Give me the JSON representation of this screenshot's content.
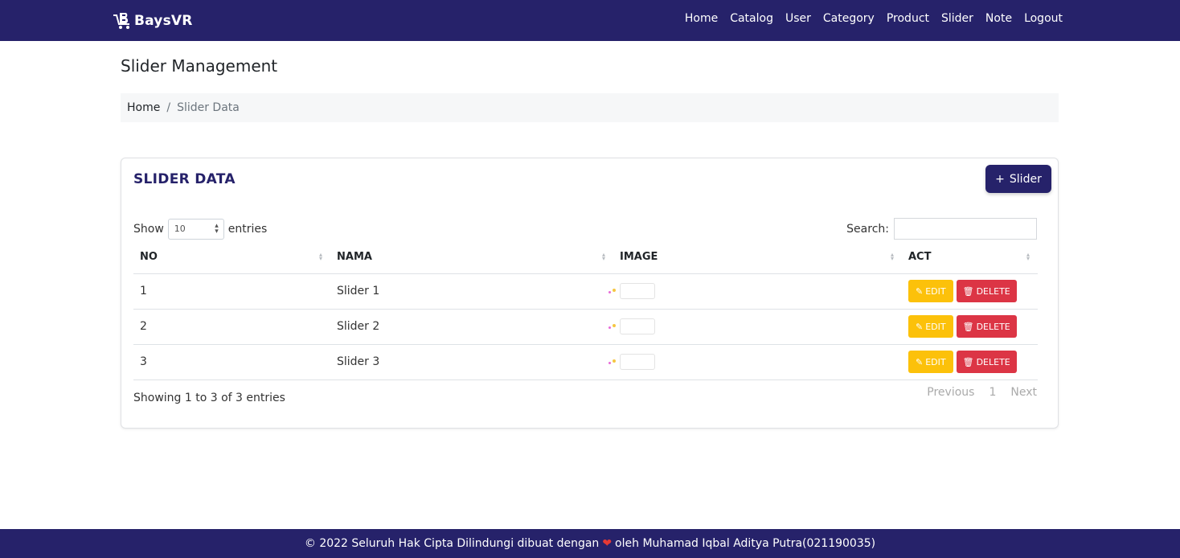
{
  "navbar": {
    "brand": "BaysVR",
    "links": [
      "Home",
      "Catalog",
      "User",
      "Category",
      "Product",
      "Slider",
      "Note",
      "Logout"
    ]
  },
  "page": {
    "title": "Slider Management",
    "breadcrumb": {
      "home": "Home",
      "separator": "/",
      "current": "Slider Data"
    }
  },
  "card": {
    "title": "SLIDER DATA",
    "add_button": "Slider",
    "show_label": "Show",
    "entries_value": "10",
    "entries_label": "entries",
    "search_label": "Search:",
    "search_value": "",
    "columns": [
      "NO",
      "NAMA",
      "IMAGE",
      "ACT"
    ],
    "rows": [
      {
        "no": "1",
        "nama": "Slider 1"
      },
      {
        "no": "2",
        "nama": "Slider 2"
      },
      {
        "no": "3",
        "nama": "Slider 3"
      }
    ],
    "edit_label": "EDIT",
    "delete_label": "DELETE",
    "info": "Showing 1 to 3 of 3 entries",
    "pager": {
      "previous": "Previous",
      "page": "1",
      "next": "Next"
    }
  },
  "footer": {
    "prefix": "© 2022 Seluruh Hak Cipta Dilindungi dibuat dengan",
    "suffix": "oleh Muhamad Iqbal Aditya Putra(021190035)"
  },
  "colors": {
    "primary": "#26226a",
    "edit": "#fcc10a",
    "delete": "#dc3545",
    "heart": "#e53935"
  },
  "icons": [
    "cart-logo-icon",
    "plus-icon",
    "edit-icon",
    "trash-icon",
    "heart-icon",
    "sort-icon"
  ]
}
